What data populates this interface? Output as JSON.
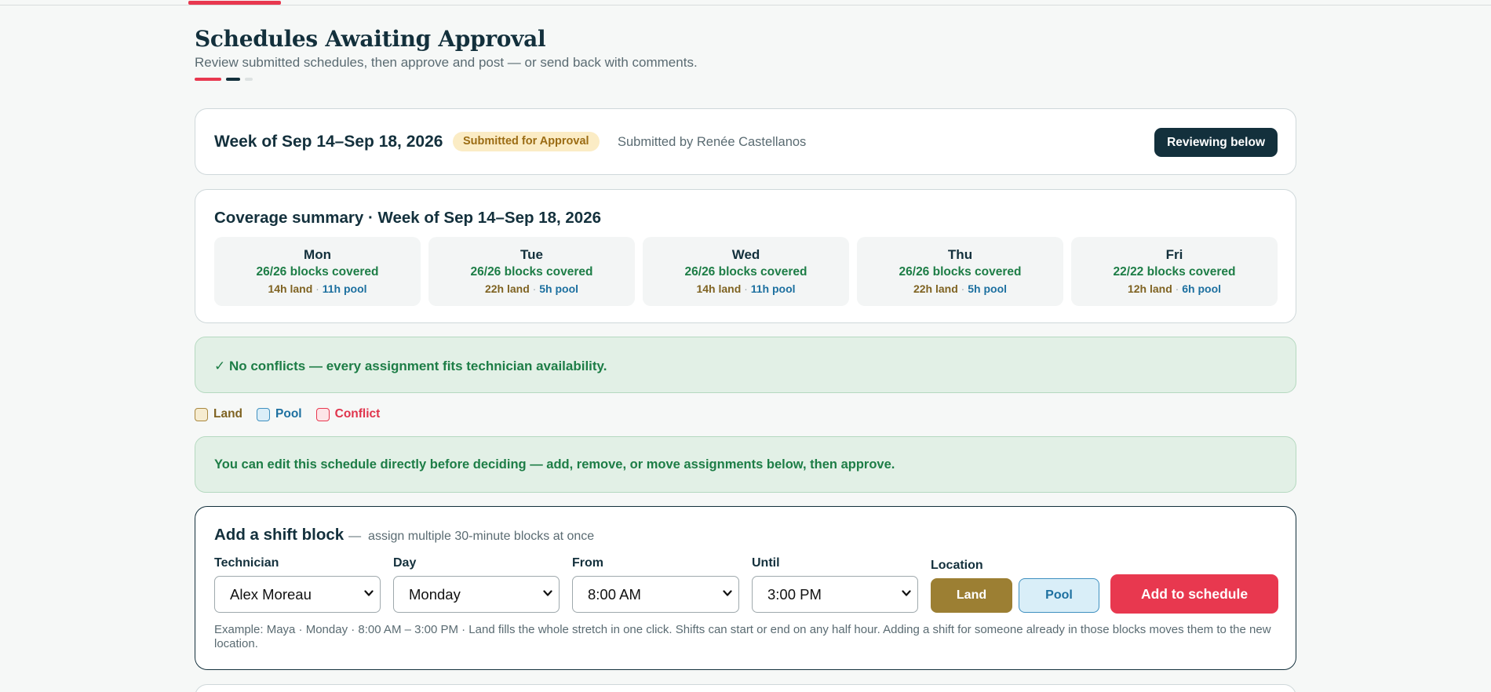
{
  "page": {
    "title": "Schedules Awaiting Approval",
    "subtitle": "Review submitted schedules, then approve and post — or send back with comments."
  },
  "week": {
    "title": "Week of Sep 14–Sep 18, 2026",
    "status": "Submitted for Approval",
    "submitted_by": "Submitted by Renée Castellanos",
    "action_label": "Reviewing below"
  },
  "coverage": {
    "title": "Coverage summary · Week of Sep 14–Sep 18, 2026",
    "days": [
      {
        "name": "Mon",
        "blocks": "26/26 blocks covered",
        "land": "14h land",
        "sep": "·",
        "pool": "11h pool"
      },
      {
        "name": "Tue",
        "blocks": "26/26 blocks covered",
        "land": "22h land",
        "sep": "·",
        "pool": "5h pool"
      },
      {
        "name": "Wed",
        "blocks": "26/26 blocks covered",
        "land": "14h land",
        "sep": "·",
        "pool": "11h pool"
      },
      {
        "name": "Thu",
        "blocks": "26/26 blocks covered",
        "land": "22h land",
        "sep": "·",
        "pool": "5h pool"
      },
      {
        "name": "Fri",
        "blocks": "22/22 blocks covered",
        "land": "12h land",
        "sep": "·",
        "pool": "6h pool"
      }
    ]
  },
  "conflicts_notice": "✓ No conflicts — every assignment fits technician availability.",
  "legend": {
    "land": "Land",
    "pool": "Pool",
    "conflict": "Conflict"
  },
  "edit_notice": "You can edit this schedule directly before deciding — add, remove, or move assignments below, then approve.",
  "add_block": {
    "title": "Add a shift block",
    "dash": "—",
    "hint": "assign multiple 30-minute blocks at once",
    "technician_label": "Technician",
    "technician_value": "Alex Moreau",
    "day_label": "Day",
    "day_value": "Monday",
    "from_label": "From",
    "from_value": "8:00 AM",
    "until_label": "Until",
    "until_value": "3:00 PM",
    "location_label": "Location",
    "land_label": "Land",
    "pool_label": "Pool",
    "add_label": "Add to schedule",
    "example": "Example: Maya · Monday · 8:00 AM – 3:00 PM · Land fills the whole stretch in one click. Shifts can start or end on any half hour. Adding a shift for someone already in those blocks moves them to the new location."
  },
  "colors": {
    "accent": "#e8384f",
    "navy": "#13303c",
    "success": "#1d7d46",
    "land": "#9c7f33",
    "pool": "#1d70a0"
  },
  "icons": {
    "select_chevron": "chevron-down-icon"
  }
}
